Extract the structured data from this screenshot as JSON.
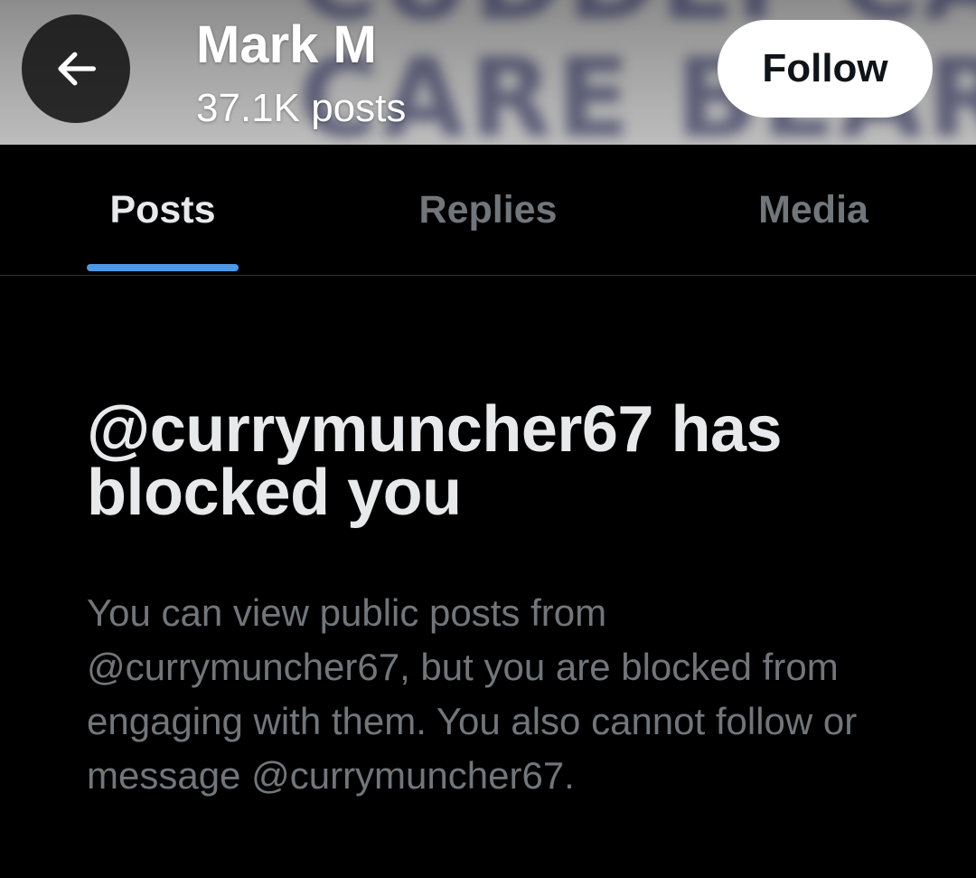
{
  "header": {
    "banner_line1": "CUDDLY CARE",
    "banner_line2": "CARE BEAR",
    "profile_name": "Mark M",
    "post_count": "37.1K posts",
    "back_icon": "arrow-left-icon",
    "follow_label": "Follow"
  },
  "tabs": [
    {
      "label": "Posts",
      "active": true
    },
    {
      "label": "Replies",
      "active": false
    },
    {
      "label": "Media",
      "active": false
    }
  ],
  "blocked": {
    "title": "@currymuncher67 has blocked you",
    "body": "You can view public posts from @currymuncher67, but you are blocked from engaging with them. You also cannot follow or message @currymuncher67."
  },
  "colors": {
    "background": "#000000",
    "accent": "#4a99e9",
    "primary_text": "#e7e9ea",
    "secondary_text": "#71767b"
  }
}
